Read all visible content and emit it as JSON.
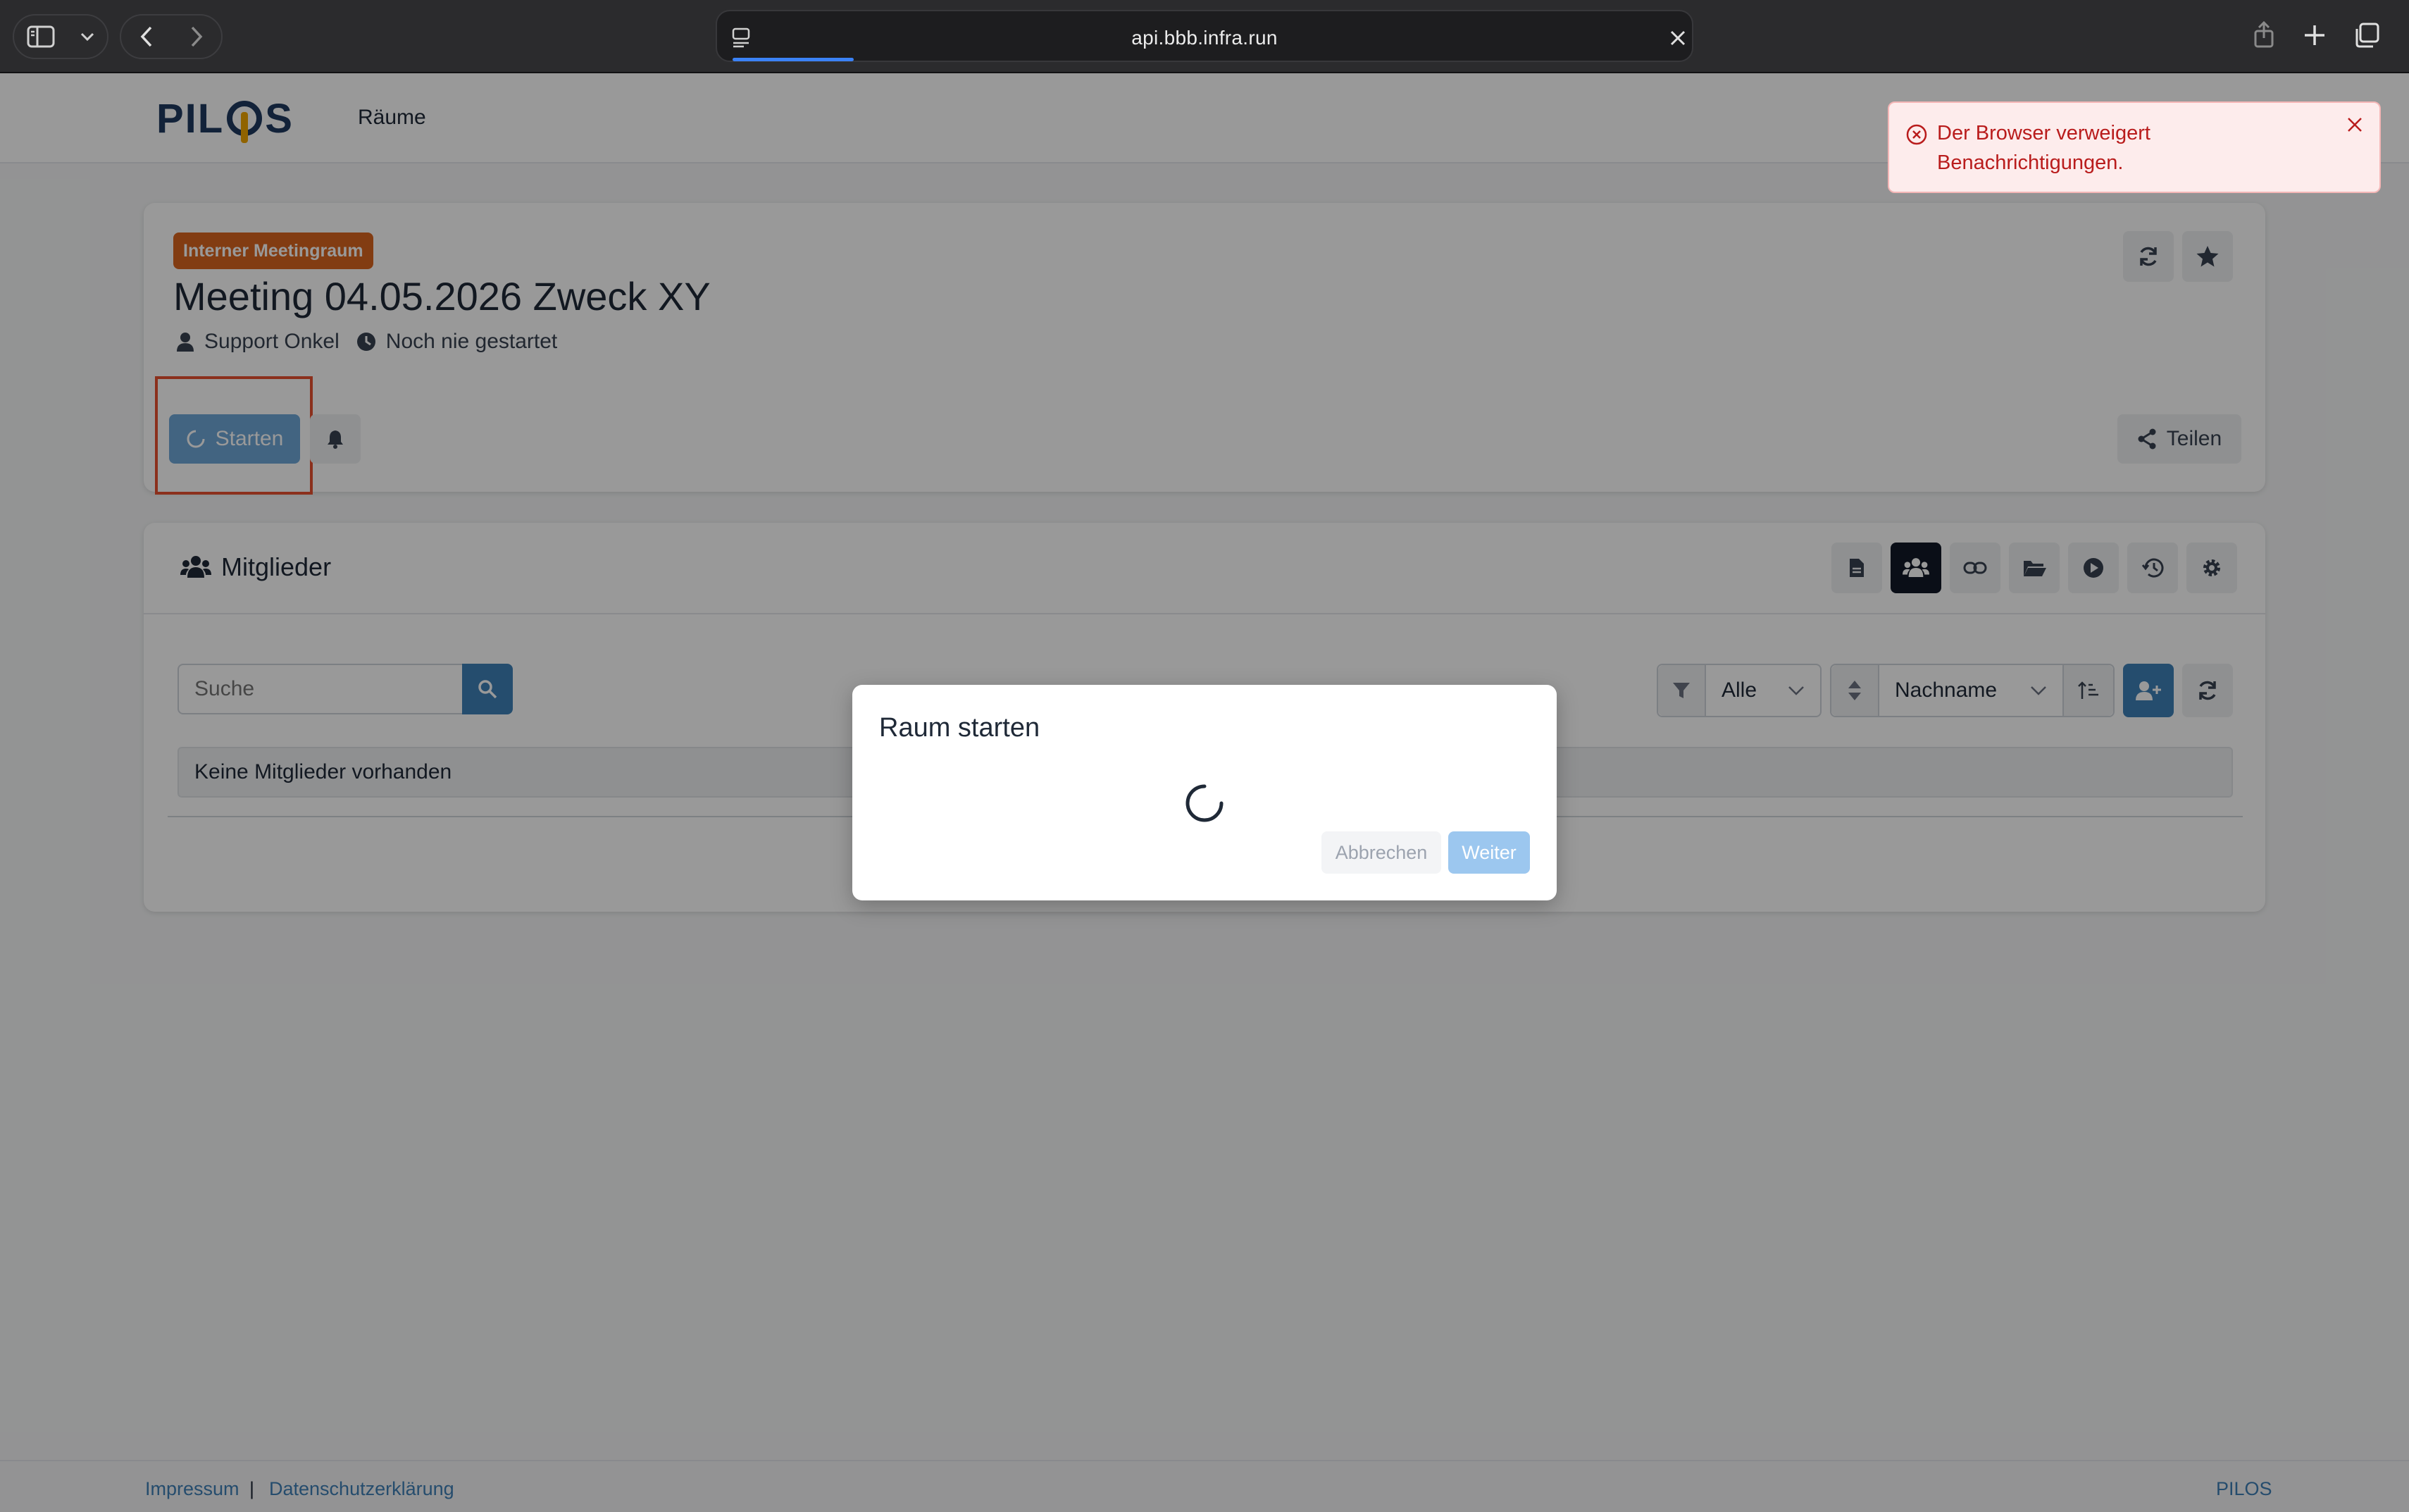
{
  "browser": {
    "url": "api.bbb.infra.run"
  },
  "nav": {
    "logo": "PILOS",
    "rooms_link": "Räume"
  },
  "toast": {
    "message": "Der Browser verweigert Benachrichtigungen."
  },
  "room": {
    "type_badge": "Interner Meetingraum",
    "title": "Meeting 04.05.2026 Zweck XY",
    "owner": "Support Onkel",
    "last_run": "Noch nie gestartet",
    "start_label": "Starten",
    "share_label": "Teilen"
  },
  "members": {
    "title": "Mitglieder",
    "search_placeholder": "Suche",
    "filter_value": "Alle",
    "sort_value": "Nachname",
    "empty_text": "Keine Mitglieder vorhanden"
  },
  "modal": {
    "title": "Raum starten",
    "cancel_label": "Abbrechen",
    "next_label": "Weiter"
  },
  "footer": {
    "imprint": "Impressum",
    "separator": "|",
    "privacy": "Datenschutzerklärung",
    "brand": "PILOS"
  },
  "colors": {
    "accent": "#3f80b7",
    "badge": "#d9641f",
    "error": "#b91c1c",
    "highlight": "#e8502f"
  }
}
